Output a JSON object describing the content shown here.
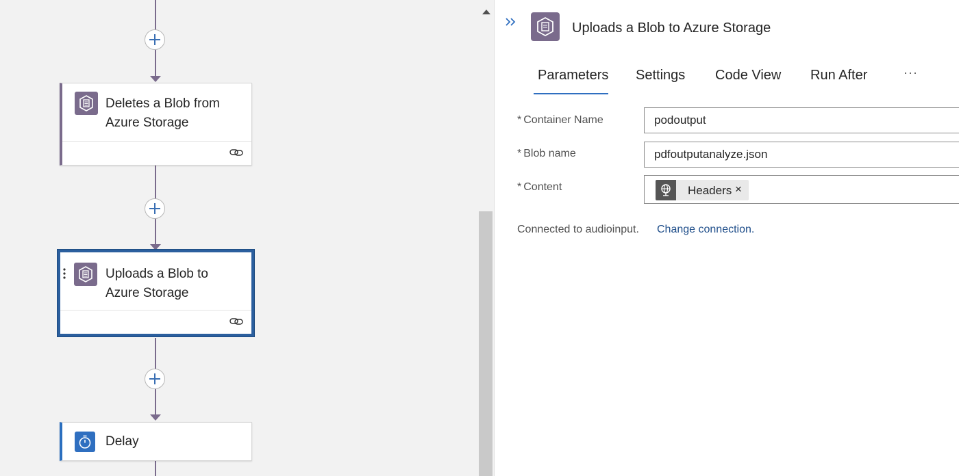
{
  "canvas": {
    "cards": [
      {
        "title": "Deletes a Blob from Azure Storage",
        "icon": "blob-storage-icon",
        "footer_icon": "link-icon"
      },
      {
        "title": "Uploads a Blob to Azure Storage",
        "icon": "blob-storage-icon",
        "footer_icon": "link-icon",
        "selected": true
      },
      {
        "title": "Delay",
        "icon": "timer-icon"
      }
    ],
    "colors": {
      "connector": "#7a6b8c",
      "storage_icon_bg": "#7a6b8c",
      "delay_icon_bg": "#2f6fc0",
      "selection_border": "#2b5f9e"
    }
  },
  "panel": {
    "title": "Uploads a Blob to Azure Storage",
    "icon": "blob-storage-icon",
    "collapse_icon": "double-chevron-right-icon",
    "tabs": [
      "Parameters",
      "Settings",
      "Code View",
      "Run After"
    ],
    "active_tab": "Parameters",
    "more_label": "···",
    "fields": {
      "container_name": {
        "label": "Container Name",
        "required": "*",
        "value": "podoutput"
      },
      "blob_name": {
        "label": "Blob name",
        "required": "*",
        "value": "pdfoutputanalyze.json"
      },
      "content": {
        "label": "Content",
        "required": "*",
        "token": "Headers",
        "token_icon": "globe-icon",
        "remove": "×"
      }
    },
    "connection_text": "Connected to audioinput.",
    "change_connection": "Change connection."
  }
}
